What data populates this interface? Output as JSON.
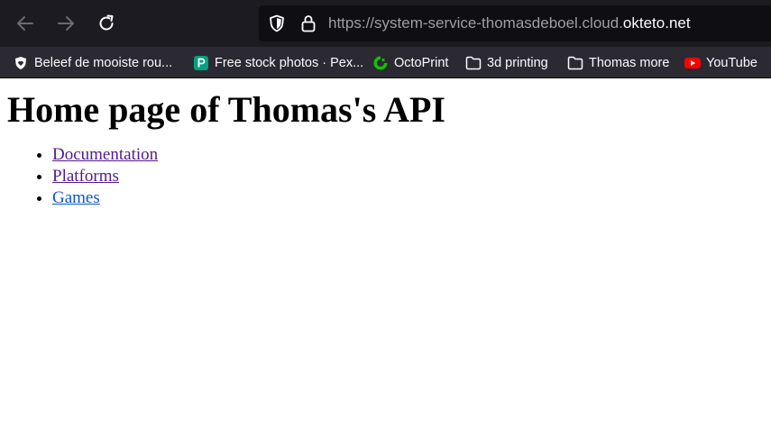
{
  "browser": {
    "url_prefix": "https://system-service-thomasdeboel.cloud.",
    "url_domain": "okteto.net",
    "icons": {
      "back": "arrow-left-icon",
      "forward": "arrow-right-icon",
      "reload": "reload-icon",
      "shield": "tracking-shield-icon",
      "lock": "lock-icon"
    },
    "bookmarks": [
      {
        "label": "Beleef de mooiste rou...",
        "icon": "shield-heart-icon"
      },
      {
        "label": "Free stock photos · Pex...",
        "icon": "pexels-icon"
      },
      {
        "label": "OctoPrint",
        "icon": "octoprint-icon"
      },
      {
        "label": "3d printing",
        "icon": "folder-icon"
      },
      {
        "label": "Thomas more",
        "icon": "folder-icon"
      },
      {
        "label": "YouTube",
        "icon": "youtube-icon"
      }
    ]
  },
  "page": {
    "heading": "Home page of Thomas's API",
    "links": [
      {
        "label": "Documentation",
        "state": "visited"
      },
      {
        "label": "Platforms",
        "state": "visited"
      },
      {
        "label": "Games",
        "state": "unvisited"
      }
    ]
  },
  "colors": {
    "toolbar_bg": "#1c1b22",
    "urlbar_bg": "#0f0e13",
    "bookmarks_bg": "#2b2a33",
    "visited_link": "#551a8b",
    "unvisited_link": "#0b57c2"
  }
}
